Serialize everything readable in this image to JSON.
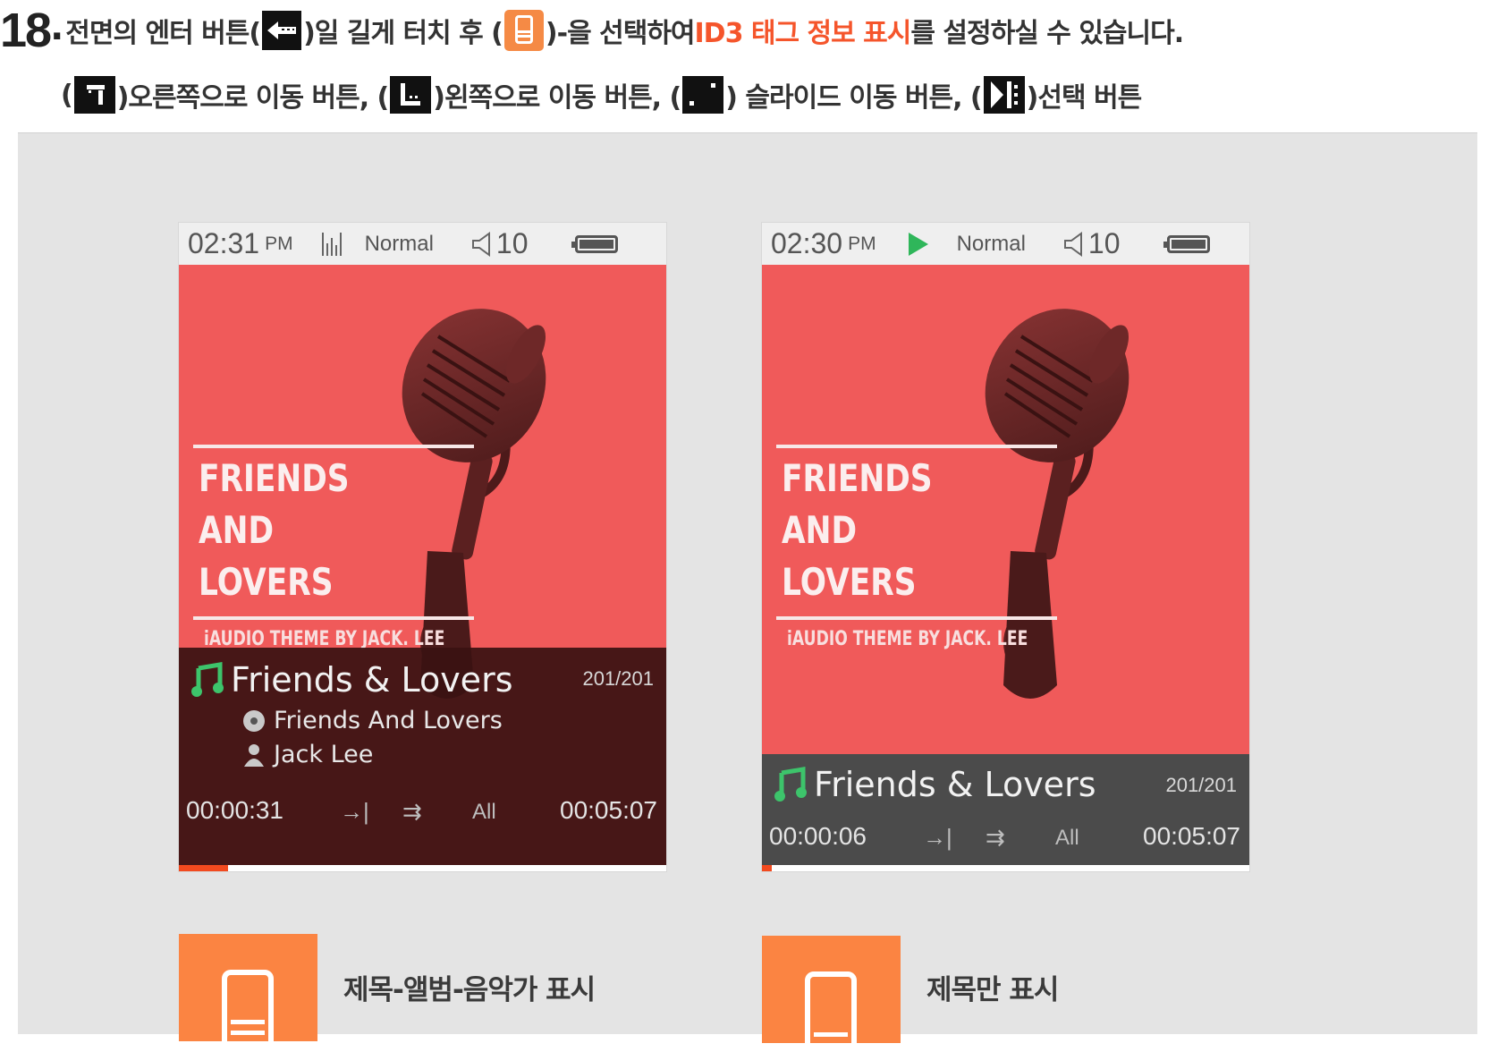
{
  "instruction": {
    "step_number": "18",
    "step_dot": ".",
    "text_before_enter": "전면의 엔터 버튼(",
    "text_after_enter": ")일 길게 터치 후 (",
    "text_after_menu": ")-을 선택하여 ",
    "highlight": "ID3 태그 정보 표시",
    "text_end": "를 설정하실 수 있습니다.",
    "accent_color": "#f5552b"
  },
  "legend": {
    "open": "(",
    "right_label": ")오른쪽으로 이동 버튼, (",
    "left_label": ")왼쪽으로 이동 버튼, (",
    "slide_label": ") 슬라이드 이동 버튼, (",
    "select_label": ")선택 버튼"
  },
  "players": [
    {
      "status": {
        "time": "02:31",
        "ampm": "PM",
        "mode": "Normal",
        "volume": "10",
        "state_icon": "equalizer-icon"
      },
      "art": {
        "title_lines": [
          "FRIENDS",
          "AND",
          "LOVERS"
        ],
        "credit": "iAUDIO THEME BY JACK. LEE"
      },
      "track": {
        "title": "Friends & Lovers",
        "count": "201/201",
        "album": "Friends And Lovers",
        "artist": "Jack Lee"
      },
      "playback": {
        "elapsed": "00:00:31",
        "total": "00:05:07",
        "repeat": "All",
        "progress_fraction": 0.1
      }
    },
    {
      "status": {
        "time": "02:30",
        "ampm": "PM",
        "mode": "Normal",
        "volume": "10",
        "state_icon": "play-icon"
      },
      "art": {
        "title_lines": [
          "FRIENDS",
          "AND",
          "LOVERS"
        ],
        "credit": "iAUDIO THEME BY JACK. LEE"
      },
      "track": {
        "title": "Friends & Lovers",
        "count": "201/201"
      },
      "playback": {
        "elapsed": "00:00:06",
        "total": "00:05:07",
        "repeat": "All",
        "progress_fraction": 0.02
      }
    }
  ],
  "options": [
    {
      "label": "제목-앨범-음악가 표시",
      "icon": "device-full-info-icon"
    },
    {
      "label": "제목만 표시",
      "icon": "device-title-only-icon"
    }
  ],
  "colors": {
    "screen_red": "#f05a5a",
    "option_orange": "#fb8442",
    "play_green": "#2fb65a",
    "progress": "#f24a1f"
  }
}
